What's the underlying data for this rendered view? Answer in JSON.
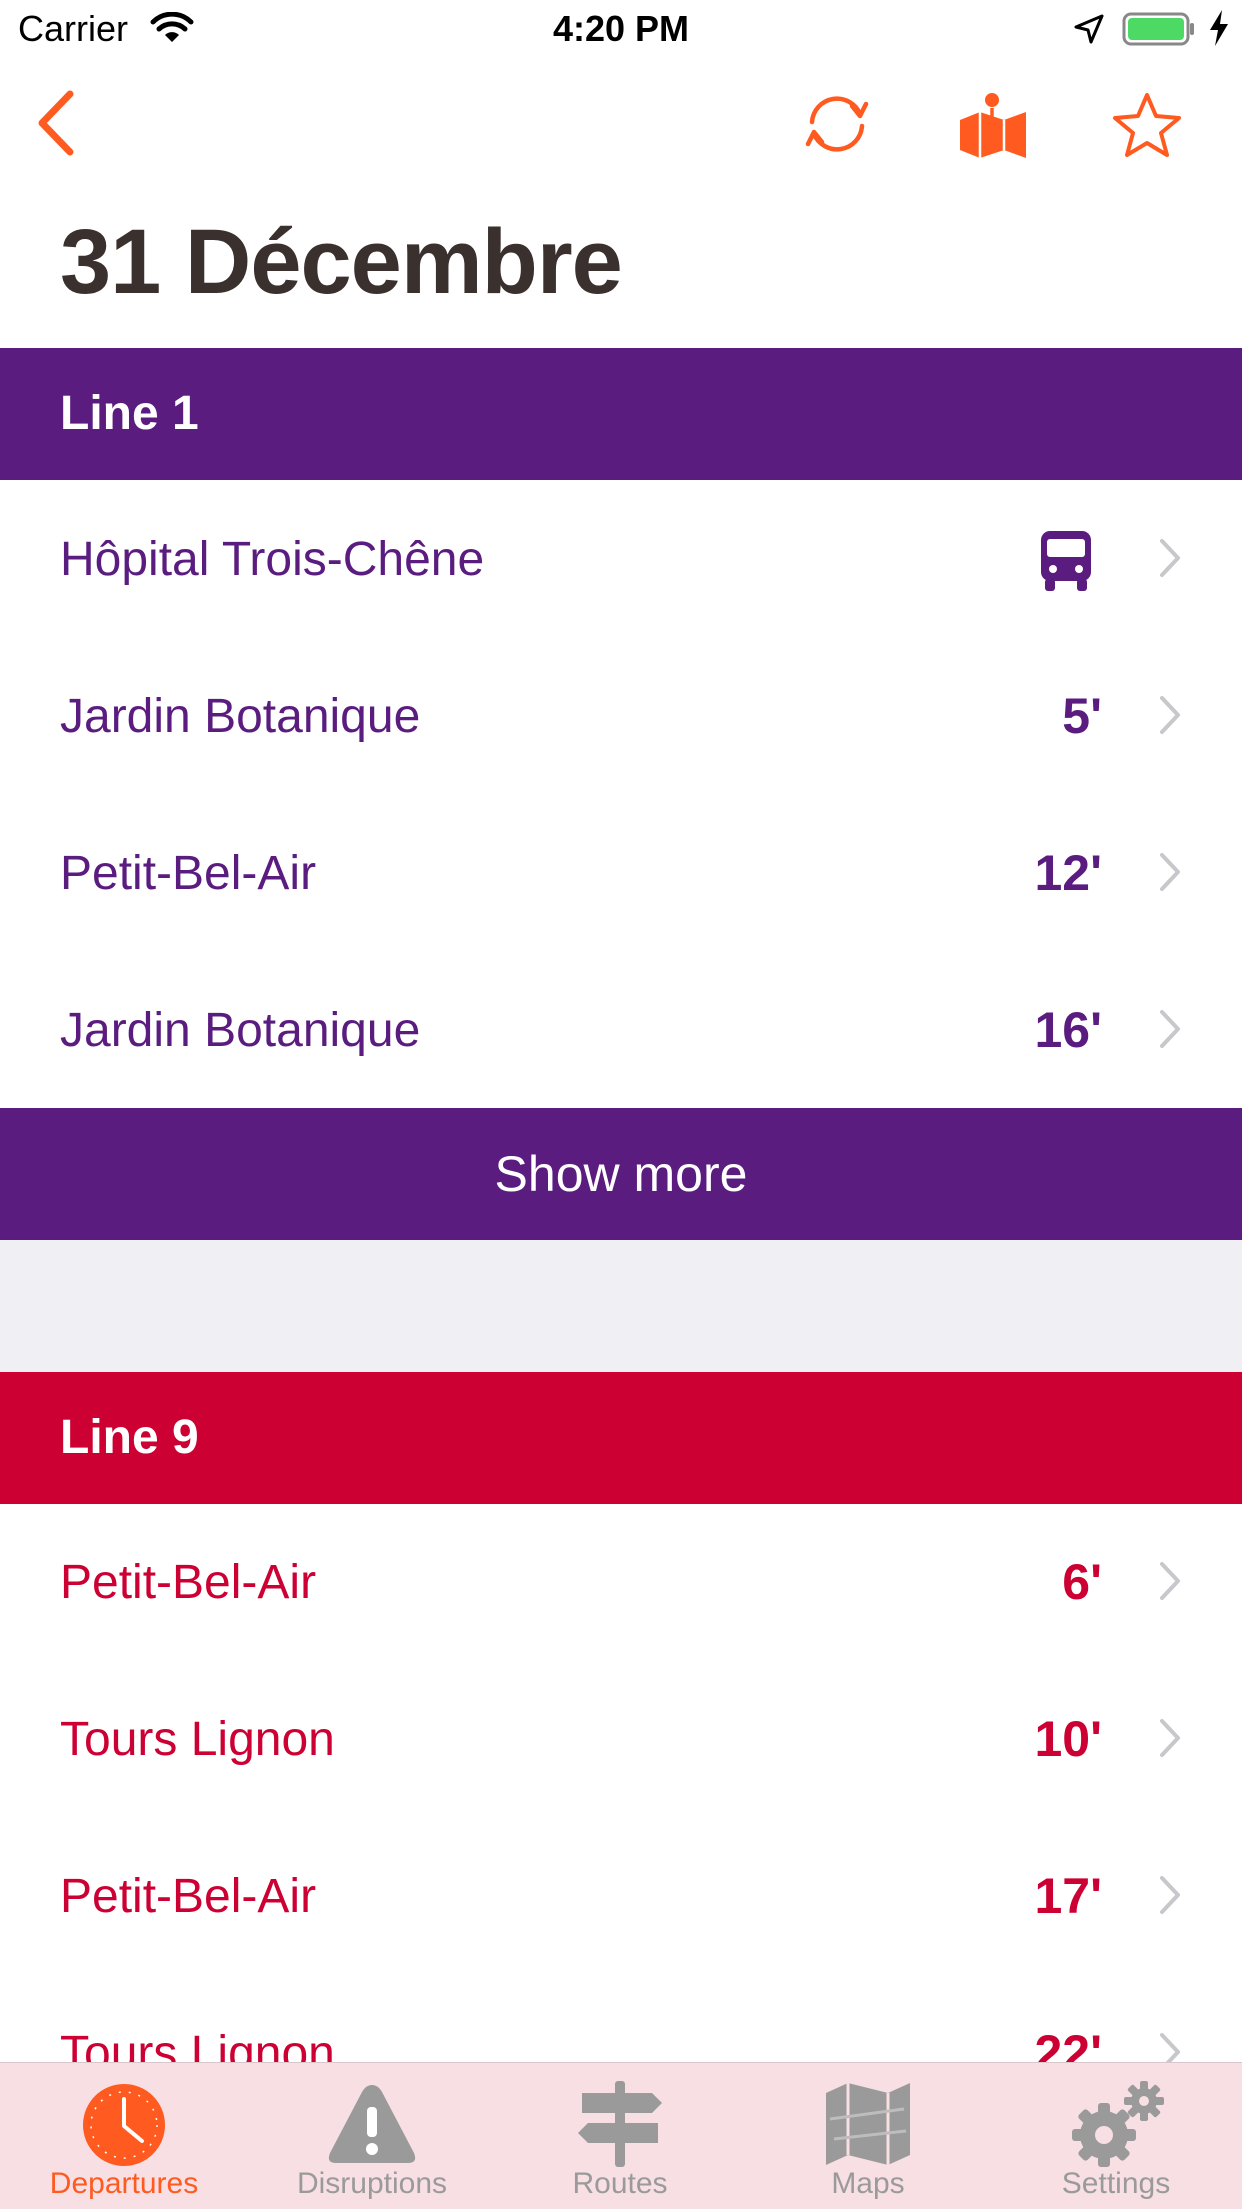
{
  "status_bar": {
    "carrier": "Carrier",
    "time": "4:20 PM"
  },
  "nav": {
    "back_icon": "chevron-left-icon",
    "refresh_icon": "refresh-icon",
    "map_icon": "map-pin-icon",
    "favorite_icon": "star-icon"
  },
  "page": {
    "title": "31 Décembre"
  },
  "colors": {
    "accent": "#ff5a1f",
    "line1": "#5b1c80",
    "line9": "#cc0033",
    "title": "#3a302e"
  },
  "sections": [
    {
      "header": "Line 1",
      "rows": [
        {
          "destination": "Hôpital Trois-Chêne",
          "time": "",
          "icon": "bus-icon"
        },
        {
          "destination": "Jardin Botanique",
          "time": "5'"
        },
        {
          "destination": "Petit-Bel-Air",
          "time": "12'"
        },
        {
          "destination": "Jardin Botanique",
          "time": "16'"
        }
      ],
      "show_more": "Show more"
    },
    {
      "header": "Line 9",
      "rows": [
        {
          "destination": "Petit-Bel-Air",
          "time": "6'"
        },
        {
          "destination": "Tours Lignon",
          "time": "10'"
        },
        {
          "destination": "Petit-Bel-Air",
          "time": "17'"
        },
        {
          "destination": "Tours Lignon",
          "time": "22'"
        }
      ]
    }
  ],
  "tabbar": {
    "tabs": [
      {
        "label": "Departures",
        "icon": "clock-icon",
        "active": true
      },
      {
        "label": "Disruptions",
        "icon": "warning-icon",
        "active": false
      },
      {
        "label": "Routes",
        "icon": "signpost-icon",
        "active": false
      },
      {
        "label": "Maps",
        "icon": "map-icon",
        "active": false
      },
      {
        "label": "Settings",
        "icon": "gear-icon",
        "active": false
      }
    ]
  }
}
